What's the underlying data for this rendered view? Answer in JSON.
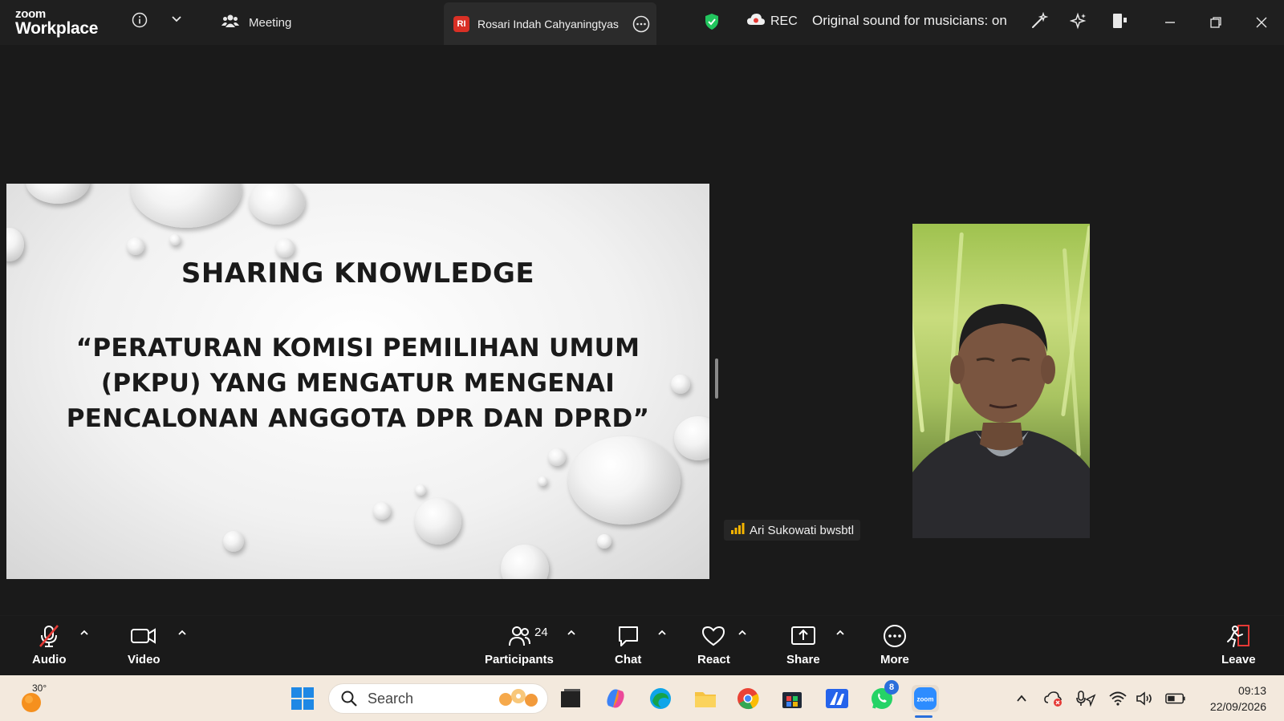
{
  "app": {
    "logo_top": "zoom",
    "logo_bottom": "Workplace"
  },
  "titlebar": {
    "meeting_label": "Meeting",
    "tab_initials": "RI",
    "tab_label": "Rosari Indah Cahyaningtyas",
    "rec_label": "REC",
    "sound_label": "Original sound for musicians: on"
  },
  "slide": {
    "title": "SHARING KNOWLEDGE",
    "subtitle": "“PERATURAN KOMISI PEMILIHAN UMUM (PKPU) YANG MENGATUR MENGENAI PENCALONAN ANGGOTA DPR DAN DPRD”"
  },
  "participant": {
    "name": "Ari Sukowati bwsbtl"
  },
  "controls": {
    "audio": "Audio",
    "video": "Video",
    "participants": "Participants",
    "participants_count": "24",
    "chat": "Chat",
    "react": "React",
    "share": "Share",
    "more": "More",
    "leave": "Leave"
  },
  "taskbar": {
    "temperature": "30°",
    "search_label": "Search",
    "whatsapp_badge": "8",
    "time": "09:13",
    "date": "22/09/2026"
  },
  "colors": {
    "background": "#1a1a1a",
    "titlebar": "#1f1f1f",
    "shield_green": "#22c55e",
    "signal_yellow": "#f5b400",
    "leave_red": "#e53935",
    "taskbar": "#f3e9dd",
    "accent_blue": "#2a6fdb"
  }
}
